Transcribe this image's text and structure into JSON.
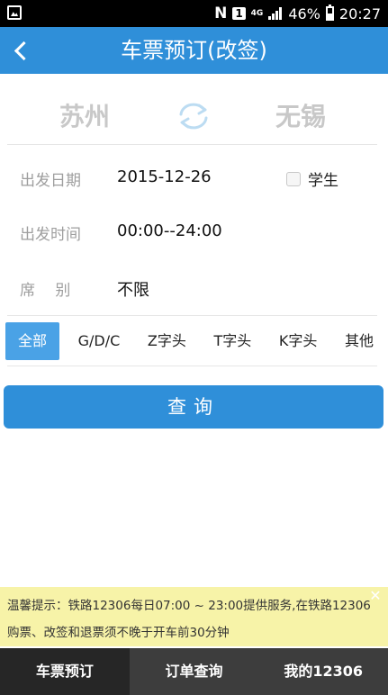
{
  "status_bar": {
    "battery": "46%",
    "time": "20:27",
    "network": "4G",
    "sim": "1"
  },
  "header": {
    "title": "车票预订(改签)"
  },
  "cities": {
    "from": "苏州",
    "to": "无锡"
  },
  "form": {
    "date_label": "出发日期",
    "date_value": "2015-12-26",
    "student_label": "学生",
    "time_label": "出发时间",
    "time_value": "00:00--24:00",
    "seat_label": "席　 别",
    "seat_value": "不限"
  },
  "filters": [
    "全部",
    "G/D/C",
    "Z字头",
    "T字头",
    "K字头",
    "其他"
  ],
  "query_button": "查询",
  "tip": {
    "line1": "温馨提示：铁路12306每日07:00 ~ 23:00提供服务,在铁路12306",
    "line2": "购票、改签和退票须不晚于开车前30分钟"
  },
  "tabs": [
    "车票预订",
    "订单查询",
    "我的12306"
  ],
  "colors": {
    "primary": "#2f8fd9",
    "active_filter": "#4aa2e6",
    "tip_background": "#f7f3a8",
    "tab_active": "#262626",
    "tab_inactive": "#3d3d3d"
  }
}
